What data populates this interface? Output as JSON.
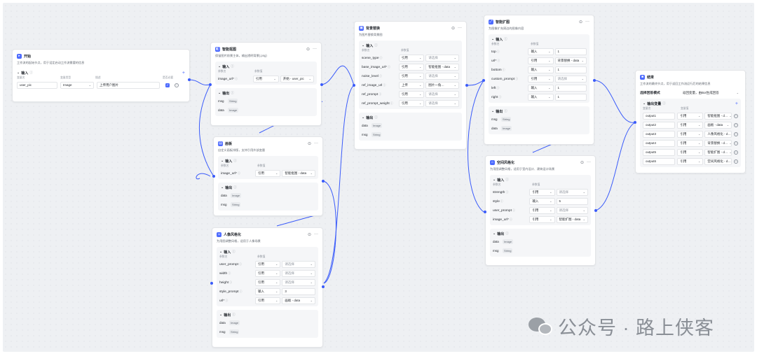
{
  "nodes": {
    "start": {
      "title": "开始",
      "desc": "工作流的起始节点，用于设定启动工作流需要的信息",
      "input_header": "输入",
      "col_name": "变量名",
      "col_type": "变量类型",
      "col_desc": "描述",
      "col_required": "是否必要",
      "param_name": "user_pic",
      "param_type": "Image",
      "param_desc": "上传用户图片"
    },
    "matting": {
      "title": "智能抠图",
      "desc": "保留图片前景主体，输出透明背景(.png)",
      "input_header": "输入",
      "col_name": "参数名",
      "col_value": "参数值",
      "param": "image_url*",
      "mode": "引用",
      "ref": "开始 - user_pic",
      "output_header": "输出",
      "outputs": [
        {
          "name": "msg",
          "type": "String"
        },
        {
          "name": "data",
          "type": "Image"
        }
      ]
    },
    "drawing": {
      "title": "画板",
      "desc": "自定义画板排版，支持引用外部变量",
      "input_header": "输入",
      "col_name": "参数名",
      "col_value": "参数值",
      "param": "image_url*",
      "mode": "引用",
      "ref": "智能抠图 - data",
      "output_header": "输出",
      "outputs": [
        {
          "name": "data",
          "type": "Image"
        },
        {
          "name": "msg",
          "type": "String"
        }
      ]
    },
    "portrait": {
      "title": "人像风格化",
      "desc": "为用图调整风格，适用于人像场景",
      "input_header": "输入",
      "col_name": "参数名",
      "col_value": "参数值",
      "params": [
        {
          "name": "user_prompt",
          "mode": "引用",
          "value": "请选择"
        },
        {
          "name": "width",
          "mode": "引用",
          "value": "请选择"
        },
        {
          "name": "height",
          "mode": "引用",
          "value": "请选择"
        },
        {
          "name": "style_prompt",
          "mode": "输入",
          "value": "3"
        },
        {
          "name": "url*",
          "mode": "引用",
          "value": "画板 - data"
        }
      ],
      "output_header": "输出",
      "outputs": [
        {
          "name": "data",
          "type": "Image"
        },
        {
          "name": "msg",
          "type": "String"
        }
      ]
    },
    "bgreplace": {
      "title": "背景替换",
      "desc": "为图片替换背景图",
      "input_header": "输入",
      "col_name": "参数名",
      "col_value": "参数值",
      "params": [
        {
          "name": "scene_type",
          "mode": "引用",
          "value": "请选择"
        },
        {
          "name": "base_image_url*",
          "mode": "引用",
          "value": "智能抠图 - data"
        },
        {
          "name": "noise_level",
          "mode": "引用",
          "value": "请选择"
        },
        {
          "name": "ref_image_url",
          "mode": "上传",
          "value": "图片一角…"
        },
        {
          "name": "ref_prompt",
          "mode": "引用",
          "value": "请选择"
        },
        {
          "name": "ref_prompt_weight",
          "mode": "引用",
          "value": "请选择"
        }
      ],
      "output_header": "输出",
      "outputs": [
        {
          "name": "data",
          "type": "Image"
        },
        {
          "name": "msg",
          "type": "String"
        }
      ]
    },
    "expand": {
      "title": "智能扩图",
      "desc": "为图像扩充周边的图像内容",
      "input_header": "输入",
      "col_name": "参数名",
      "col_value": "参数值",
      "params": [
        {
          "name": "top",
          "mode": "输入",
          "value": "1"
        },
        {
          "name": "url*",
          "mode": "引用",
          "value": "背景替换 - data"
        },
        {
          "name": "bottom",
          "mode": "输入",
          "value": "1"
        },
        {
          "name": "custom_prompt",
          "mode": "引用",
          "value": "请选择"
        },
        {
          "name": "left",
          "mode": "输入",
          "value": "1"
        },
        {
          "name": "right",
          "mode": "输入",
          "value": "1"
        }
      ],
      "output_header": "输出",
      "outputs": [
        {
          "name": "msg",
          "type": "String"
        },
        {
          "name": "data",
          "type": "Image"
        }
      ]
    },
    "space": {
      "title": "空间风格化",
      "desc": "为用图调整风格，适用于室内设计、建筑设计场景",
      "input_header": "输入",
      "col_name": "参数名",
      "col_value": "参数值",
      "params": [
        {
          "name": "strength",
          "mode": "引用",
          "value": "请选择"
        },
        {
          "name": "style",
          "mode": "输入",
          "value": "5"
        },
        {
          "name": "user_prompt",
          "mode": "引用",
          "value": "请选择"
        },
        {
          "name": "image_url*",
          "mode": "引用",
          "value": "智能扩图 - data"
        }
      ],
      "output_header": "输出",
      "outputs": [
        {
          "name": "data",
          "type": "Image"
        },
        {
          "name": "msg",
          "type": "String"
        }
      ]
    },
    "end": {
      "title": "结束",
      "desc": "工作流的最终节点，用于返回工作流运行后的结果信息",
      "mode_label": "选择回答模式",
      "mode_value": "返回变量，由Bot生成回答",
      "output_header": "输出变量",
      "col_name": "变量名",
      "col_value": "变量值",
      "outputs": [
        {
          "name": "output1",
          "mode": "引用",
          "value": "智能抠图 - d…"
        },
        {
          "name": "output2",
          "mode": "引用",
          "value": "画板 - data"
        },
        {
          "name": "output3",
          "mode": "引用",
          "value": "人像风格化 - d…"
        },
        {
          "name": "output4",
          "mode": "引用",
          "value": "背景替换 - d…"
        },
        {
          "name": "output5",
          "mode": "引用",
          "value": "智能扩图 - d…"
        },
        {
          "name": "output6",
          "mode": "引用",
          "value": "空间风格化 - d…"
        }
      ]
    }
  },
  "watermark": "公众号 · 路上侠客",
  "colors": {
    "accent": "#3a5bfa",
    "canvas": "#eef0f3",
    "node_bg": "#ffffff"
  }
}
